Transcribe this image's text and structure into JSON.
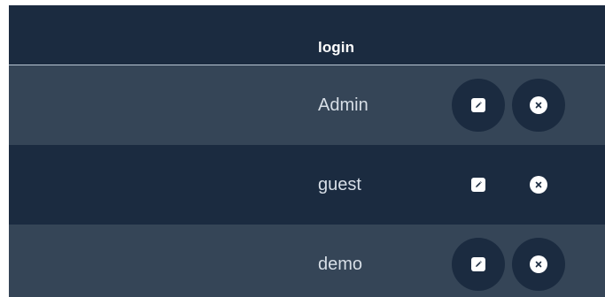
{
  "table": {
    "header": {
      "login": "login"
    },
    "rows": [
      {
        "login": "Admin",
        "actions": [
          "edit-icon",
          "delete-icon"
        ]
      },
      {
        "login": "guest",
        "actions": [
          "edit-icon",
          "delete-icon"
        ]
      },
      {
        "login": "demo",
        "actions": [
          "edit-icon",
          "delete-icon"
        ]
      }
    ]
  },
  "colors": {
    "header_bg": "#1b2b40",
    "row_dark": "#1b2b40",
    "row_light": "#354557",
    "text": "#ffffff",
    "divider": "#b9c6d4"
  }
}
